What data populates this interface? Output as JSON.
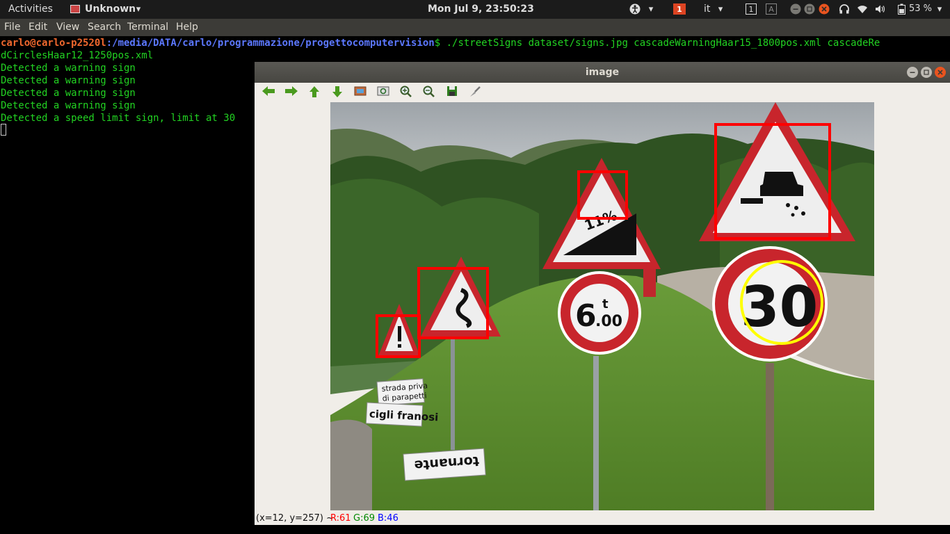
{
  "topbar": {
    "activities": "Activities",
    "app_name": "Unknown",
    "clock": "Mon Jul  9, 23:50:23",
    "input_lang": "it",
    "notif_badge": "1",
    "workspace_1": "1",
    "workspace_2": "A",
    "battery": "53 %"
  },
  "terminal": {
    "menu": [
      "File",
      "Edit",
      "View",
      "Search",
      "Terminal",
      "Help"
    ],
    "prompt_user": "carlo@carlo-p2520l",
    "prompt_path": ":/media/DATA/carlo/programmazione/progettocomputervision",
    "command_part1": "$ ./streetSigns dataset/signs.jpg cascadeWarningHaar15_1800pos.xml cascadeRe",
    "command_part2": "dCirclesHaar12_1250pos.xml",
    "output": [
      "Detected a warning sign",
      "Detected a warning sign",
      "Detected a warning sign",
      "Detected a warning sign",
      "Detected a speed limit sign, limit at 30"
    ]
  },
  "image_window": {
    "title": "image",
    "status_coords": "(x=12, y=257) ~",
    "status_r": "R:61",
    "status_g": "G:69",
    "status_b": "B:46",
    "status_colors": {
      "r": "#ff0000",
      "g": "#008800",
      "b": "#0000ff"
    },
    "sign_texts": {
      "grade": "11%",
      "weight_limit_number": "6",
      "weight_limit_unit": "t",
      "weight_limit_decimals": ".00",
      "speed_limit": "30",
      "plate_1_line1": "strada priva",
      "plate_1_line2": "di parapetti",
      "plate_2": "cigli franosi",
      "plate_3": "tornante"
    }
  }
}
